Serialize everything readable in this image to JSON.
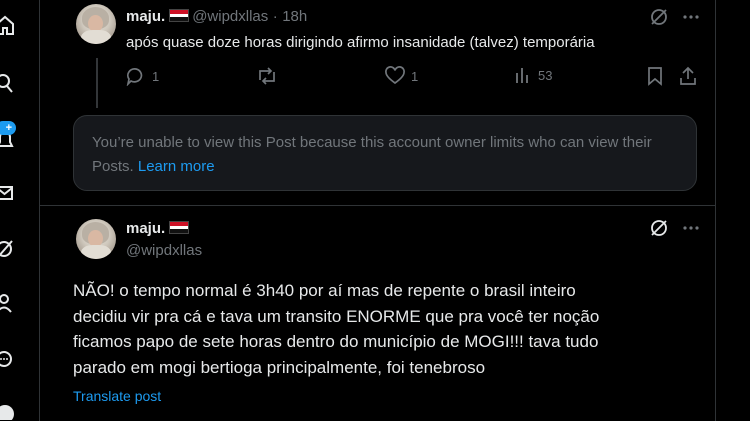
{
  "replied_post": {
    "author_name": "maju.",
    "author_handle": "@wipdxllas",
    "separator": "·",
    "timestamp": "18h",
    "text": "após quase doze horas dirigindo afirmo insanidade (talvez) temporária",
    "reply_count": "1",
    "like_count": "1",
    "view_count": "53"
  },
  "restricted_notice": {
    "text": "You’re unable to view this Post because this account owner limits who can view their Posts.",
    "link_label": "Learn more"
  },
  "main_post": {
    "author_name": "maju.",
    "author_handle": "@wipdxllas",
    "lines": [
      "NÃO! o tempo normal é 3h40 por aí mas de repente o brasil inteiro",
      "decidiu vir pra cá e tava um transito ENORME que pra você ter noção",
      "ficamos papo de sete horas dentro do município de MOGI!!! tava tudo",
      "parado em mogi bertioga principalmente, foi tenebroso"
    ],
    "translate_label": "Translate post"
  },
  "nav_badge": "+",
  "colors": {
    "background": "#000000",
    "accent": "#1d9bf0",
    "text_primary": "#e7e9ea",
    "text_secondary": "#71767b",
    "border": "#2f3336"
  }
}
